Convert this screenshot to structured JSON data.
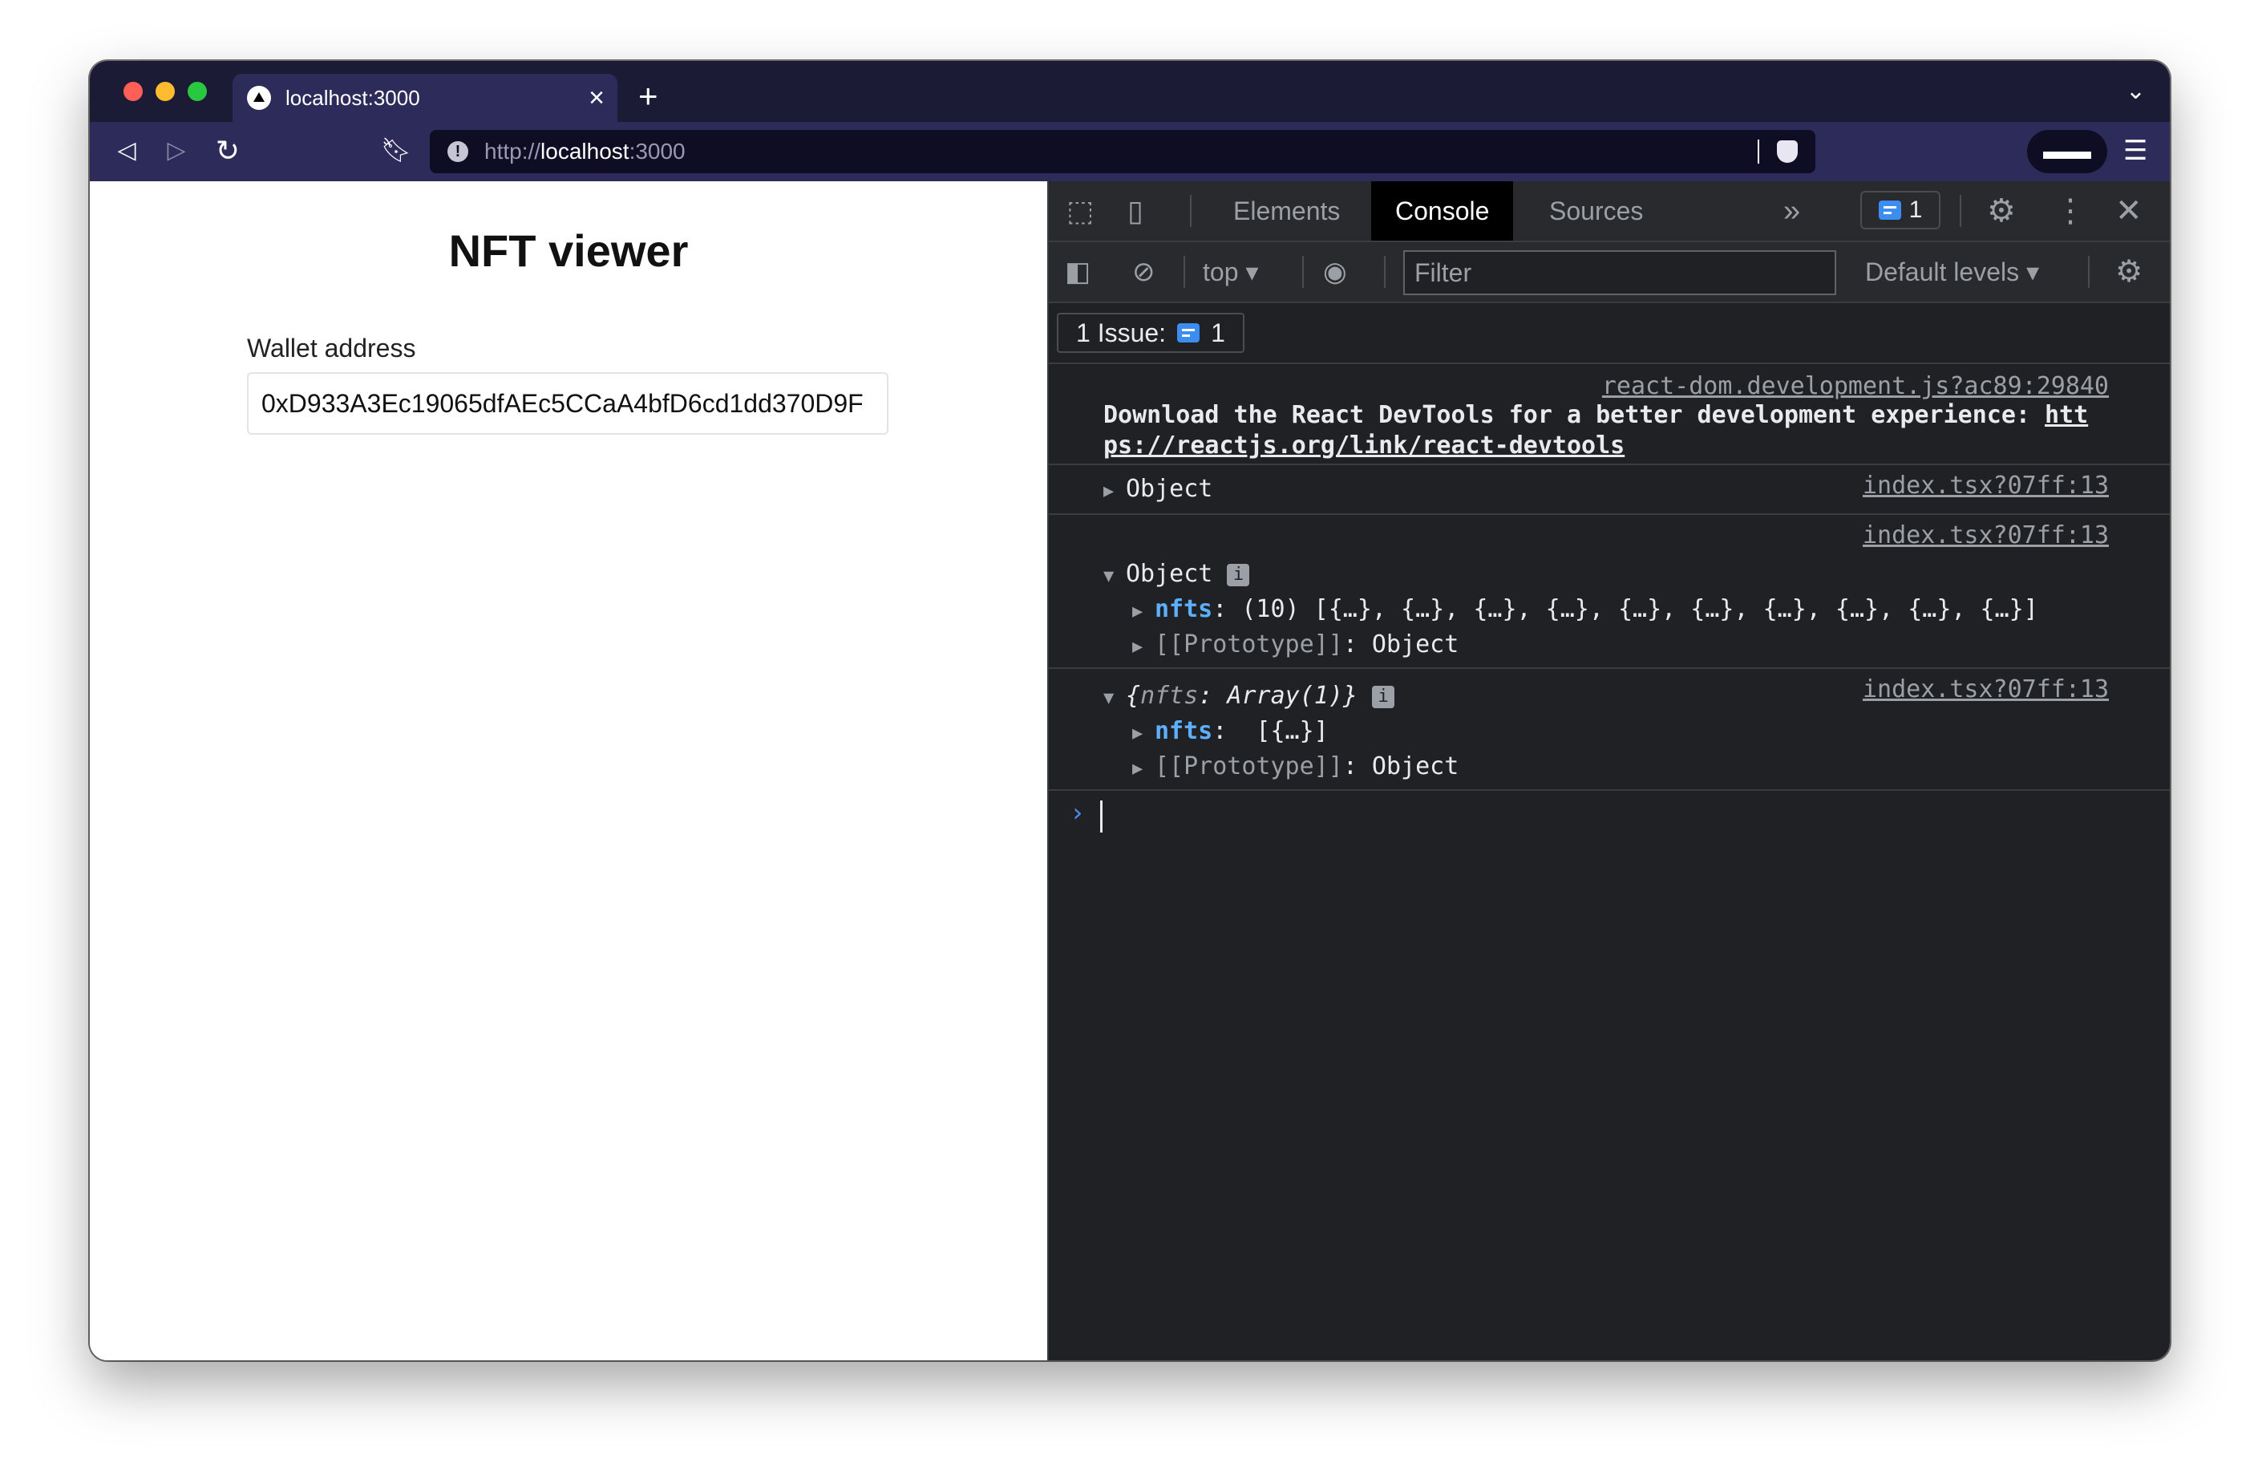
{
  "browser": {
    "tab_title": "localhost:3000",
    "url_scheme": "http://",
    "url_host": "localhost",
    "url_port": ":3000"
  },
  "page": {
    "title": "NFT viewer",
    "wallet_label": "Wallet address",
    "wallet_value": "0xD933A3Ec19065dfAEc5CCaA4bfD6cd1dd370D9F"
  },
  "devtools": {
    "tabs": [
      "Elements",
      "Console",
      "Sources"
    ],
    "active_tab": "Console",
    "messages_badge_count": "1",
    "context": "top",
    "filter_placeholder": "Filter",
    "levels": "Default levels",
    "issues_label": "1 Issue:",
    "issues_count": "1",
    "entries": [
      {
        "source": "react-dom.development.js?ac89:29840",
        "text_line1": "Download the React DevTools for a better development experience: ",
        "link_part1": "htt",
        "link_part2": "ps://reactjs.org/link/react-devtools"
      },
      {
        "source": "index.tsx?07ff:13",
        "label": "Object"
      },
      {
        "source": "index.tsx?07ff:13",
        "label": "Object",
        "info": "i",
        "child1_key": "nfts",
        "child1_value": ": (10) [{…}, {…}, {…}, {…}, {…}, {…}, {…}, {…}, {…}, {…}]",
        "child2_key": "[[Prototype]]",
        "child2_value": ": Object"
      },
      {
        "source": "index.tsx?07ff:13",
        "label_open": "{",
        "label_key": "nfts",
        "label_rest": ": Array(1)}",
        "info": "i",
        "child1_key": "nfts",
        "child1_value": ":  [{…}]",
        "child2_key": "[[Prototype]]",
        "child2_value": ": Object"
      }
    ]
  },
  "colors": {
    "tabstrip": "#1c1b36",
    "toolbar": "#2d2b5a",
    "devtools_bg": "#202124",
    "key_blue": "#5db0ff"
  }
}
